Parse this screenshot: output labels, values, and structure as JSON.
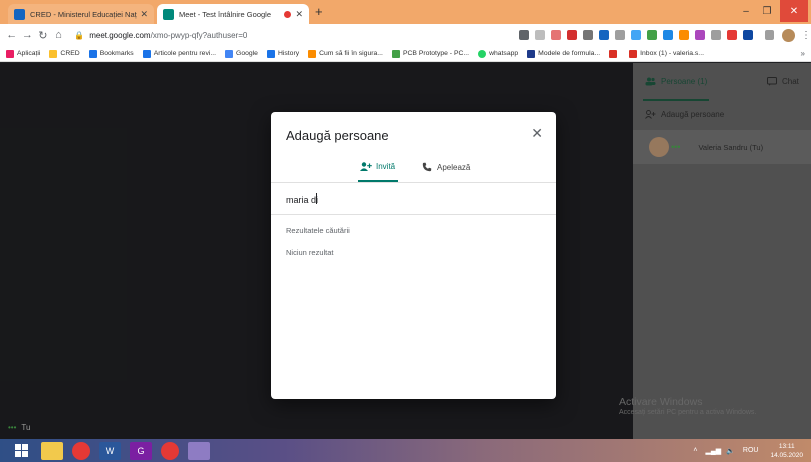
{
  "browser": {
    "tabs": [
      {
        "title": "CRED - Ministerul Educației Naț",
        "favicon_color": "#1565c0",
        "active": false
      },
      {
        "title": "Meet - Test întâlnire Google",
        "favicon_color": "#00897b",
        "active": true
      }
    ],
    "new_tab": "+",
    "window_controls": {
      "minimize": "–",
      "maximize": "❐",
      "close": "✕"
    },
    "url_host": "meet.google.com",
    "url_path": "/xmo-pwyp-qfy?authuser=0",
    "bookmarks": [
      {
        "label": "Aplicații",
        "color": "#e91e63"
      },
      {
        "label": "CRED",
        "color": "#fbc02d"
      },
      {
        "label": "Bookmarks",
        "color": "#1a73e8"
      },
      {
        "label": "Articole pentru revi...",
        "color": "#1a73e8"
      },
      {
        "label": "Google",
        "color": "#4285f4"
      },
      {
        "label": "History",
        "color": "#1a73e8"
      },
      {
        "label": "Cum să fii în sigura...",
        "color": "#fb8c00"
      },
      {
        "label": "PCB Prototype - PC...",
        "color": "#43a047"
      },
      {
        "label": "whatsapp",
        "color": "#25d366"
      },
      {
        "label": "Modele de formula...",
        "color": "#1e3a8a"
      },
      {
        "label": "",
        "color": "#d93025"
      },
      {
        "label": "Inbox (1) - valeria.s...",
        "color": "#d93025"
      }
    ],
    "bookmarks_more": "»"
  },
  "meet": {
    "self_label": "Tu",
    "side": {
      "people_tab": "Persoane (1)",
      "chat_tab": "Chat",
      "add_people": "Adaugă persoane",
      "participants": [
        {
          "name": "Valeria Sandru (Tu)"
        }
      ]
    },
    "dialog": {
      "title": "Adaugă persoane",
      "tab_invite": "Invită",
      "tab_call": "Apelează",
      "search_value": "maria di",
      "results_heading": "Rezultatele căutării",
      "no_results": "Niciun rezultat"
    },
    "watermark": {
      "line1": "Activare Windows",
      "line2": "Accesați setări PC pentru a activa Windows."
    }
  },
  "taskbar": {
    "apps": [
      {
        "name": "start",
        "color": "#ffffff"
      },
      {
        "name": "explorer",
        "color": "#f2c94c"
      },
      {
        "name": "chrome",
        "color": "#e53935"
      },
      {
        "name": "word",
        "color": "#2b579a"
      },
      {
        "name": "pdf",
        "color": "#7b1fa2"
      },
      {
        "name": "chrome2",
        "color": "#e53935"
      },
      {
        "name": "paint",
        "color": "#8e7cc3"
      }
    ],
    "tray": {
      "lang": "ROU",
      "time": "13:11",
      "date": "14.05.2020"
    }
  }
}
